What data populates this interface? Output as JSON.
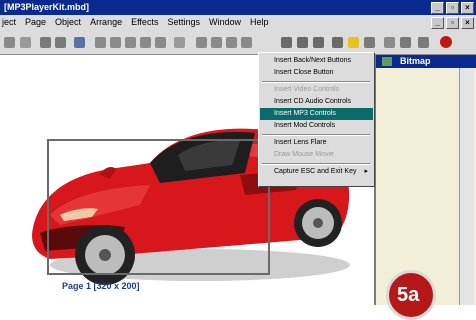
{
  "window": {
    "title": "[MP3PlayerKit.mbd]"
  },
  "menubar": {
    "items": [
      "ject",
      "Page",
      "Object",
      "Arrange",
      "Effects",
      "Settings",
      "Window",
      "Help"
    ]
  },
  "context_menu": {
    "items": [
      {
        "label": "Insert Back/Next Buttons",
        "state": "normal"
      },
      {
        "label": "Insert Close Button",
        "state": "normal"
      },
      {
        "label": "Insert Video Controls",
        "state": "disabled"
      },
      {
        "label": "Insert CD Audio Controls",
        "state": "normal"
      },
      {
        "label": "Insert MP3 Controls",
        "state": "selected"
      },
      {
        "label": "Insert Mod Controls",
        "state": "normal"
      },
      {
        "label": "Insert Lens Flare",
        "state": "normal"
      },
      {
        "label": "Draw Mouse Movie",
        "state": "disabled"
      },
      {
        "label": "Capture ESC and Exit Key",
        "state": "normal"
      }
    ]
  },
  "panel": {
    "header": "Bitmap"
  },
  "page_label": "Page 1 [320 x 200]",
  "badge": "5a",
  "colors": {
    "titlebar": "#0b2a8f",
    "selection": "#0b6b6b",
    "car": "#d8171c"
  }
}
